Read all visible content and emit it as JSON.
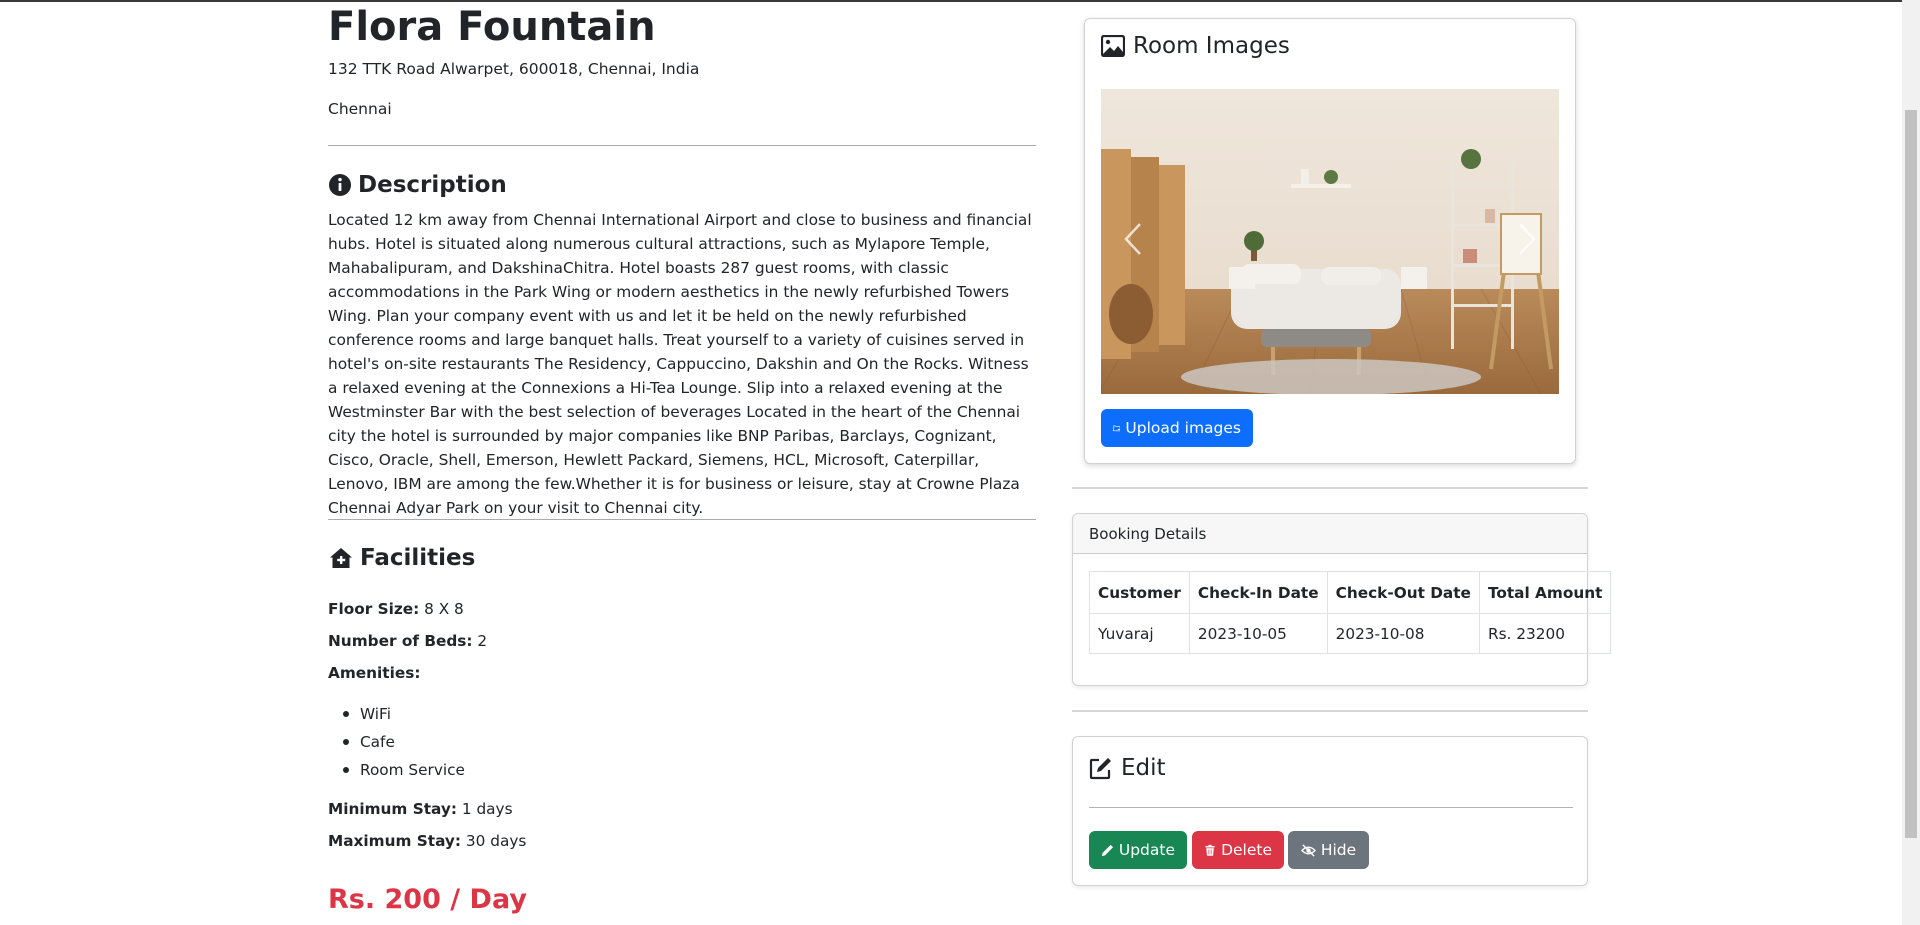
{
  "hotel": {
    "name": "Flora Fountain",
    "address": "132 TTK Road Alwarpet, 600018, Chennai, India",
    "city": "Chennai"
  },
  "description": {
    "heading": "Description",
    "text": "Located 12 km away from Chennai International Airport and close to business and financial hubs. Hotel is situated along numerous cultural attractions, such as Mylapore Temple, Mahabalipuram, and DakshinaChitra. Hotel boasts 287 guest rooms, with classic accommodations in the Park Wing or modern aesthetics in the newly refurbished Towers Wing. Plan your company event with us and let it be held on the newly refurbished conference rooms and large banquet halls. Treat yourself to a variety of cuisines served in hotel's on-site restaurants The Residency, Cappuccino, Dakshin and On the Rocks. Witness a relaxed evening at the Connexions a Hi-Tea Lounge. Slip into a relaxed evening at the Westminster Bar with the best selection of beverages Located in the heart of the Chennai city the hotel is surrounded by major companies like BNP Paribas, Barclays, Cognizant, Cisco, Oracle, Shell, Emerson, Hewlett Packard, Siemens, HCL, Microsoft, Caterpillar, Lenovo, IBM are among the few.Whether it is for business or leisure, stay at Crowne Plaza Chennai Adyar Park on your visit to Chennai city."
  },
  "facilities": {
    "heading": "Facilities",
    "floor_size_label": "Floor Size:",
    "floor_size": "8 X 8",
    "beds_label": "Number of Beds:",
    "beds": "2",
    "amenities_label": "Amenities:",
    "amenities": [
      "WiFi",
      "Cafe",
      "Room Service"
    ],
    "min_stay_label": "Minimum Stay:",
    "min_stay": "1 days",
    "max_stay_label": "Maximum Stay:",
    "max_stay": "30 days"
  },
  "price": "Rs. 200 / Day",
  "room_images": {
    "heading": "Room Images",
    "upload_label": "Upload images"
  },
  "booking": {
    "header": "Booking Details",
    "columns": [
      "Customer",
      "Check-In Date",
      "Check-Out Date",
      "Total Amount"
    ],
    "rows": [
      [
        "Yuvaraj",
        "2023-10-05",
        "2023-10-08",
        "Rs. 23200"
      ]
    ]
  },
  "edit": {
    "heading": "Edit",
    "update_label": "Update",
    "delete_label": "Delete",
    "hide_label": "Hide"
  },
  "colors": {
    "price": "#dc3545",
    "primary": "#0d6efd",
    "success": "#198754",
    "danger": "#dc3545",
    "secondary": "#6c757d"
  },
  "icons": [
    "info-circle-icon",
    "house-add-icon",
    "image-icon",
    "folder-upload-icon",
    "pencil-square-icon",
    "pencil-icon",
    "trash-icon",
    "eye-slash-icon"
  ]
}
